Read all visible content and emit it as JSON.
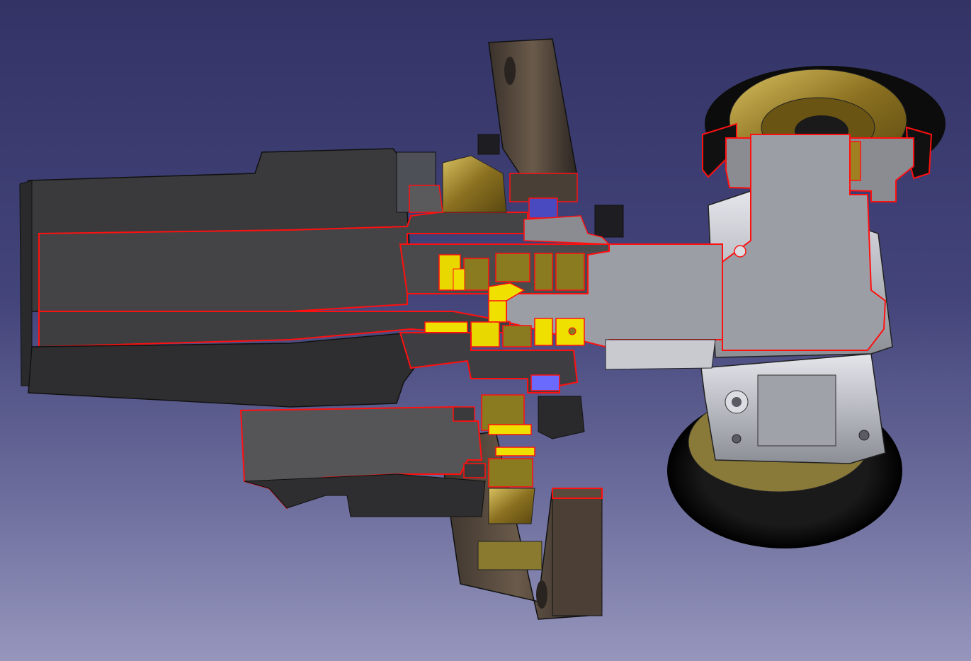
{
  "app": {
    "view": "3d-viewport",
    "background_gradient": [
      "#333366",
      "#9696bd"
    ]
  },
  "colors": {
    "section_outline": "#ff1010",
    "motor_body": "#3c3c3e",
    "section_fill_dark": "#4a4a4c",
    "section_fill_light": "#9c9ea6",
    "bearing_yellow": "#f0e000",
    "gear_gold": "#a08a2a",
    "frame_brown": "#4a3f36",
    "highlight_blue": "#6a6aff",
    "tire_black": "#0c0c0c",
    "metal_light": "#c8cad0"
  },
  "icons": [
    "cross-section-model",
    "motor-housing",
    "planetary-gear",
    "wheel-tire",
    "mounting-bracket"
  ]
}
